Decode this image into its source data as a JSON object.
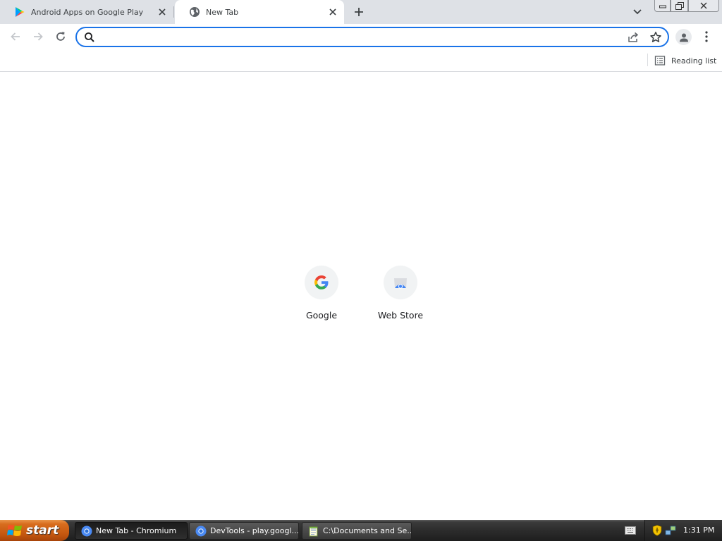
{
  "tabs": [
    {
      "title": "Android Apps on Google Play",
      "favicon": "google-play-icon",
      "active": false
    },
    {
      "title": "New Tab",
      "favicon": "globe-icon",
      "active": true
    }
  ],
  "toolbar": {
    "omnibox_value": "",
    "omnibox_placeholder": ""
  },
  "bookmarks_bar": {
    "reading_list_label": "Reading list"
  },
  "ntp": {
    "shortcuts": [
      {
        "label": "Google",
        "icon": "google-g-icon"
      },
      {
        "label": "Web Store",
        "icon": "web-store-icon"
      }
    ]
  },
  "taskbar": {
    "start_label": "start",
    "tasks": [
      {
        "label": "New Tab - Chromium",
        "icon": "chromium-icon",
        "active": true
      },
      {
        "label": "DevTools - play.googl...",
        "icon": "chromium-icon",
        "active": false
      },
      {
        "label": "C:\\Documents and Se...",
        "icon": "notepad-icon",
        "active": false
      }
    ],
    "clock": "1:31 PM"
  },
  "colors": {
    "tabstrip_bg": "#dee1e6",
    "accent": "#1a73e8",
    "start_button": "#d86d1e"
  }
}
